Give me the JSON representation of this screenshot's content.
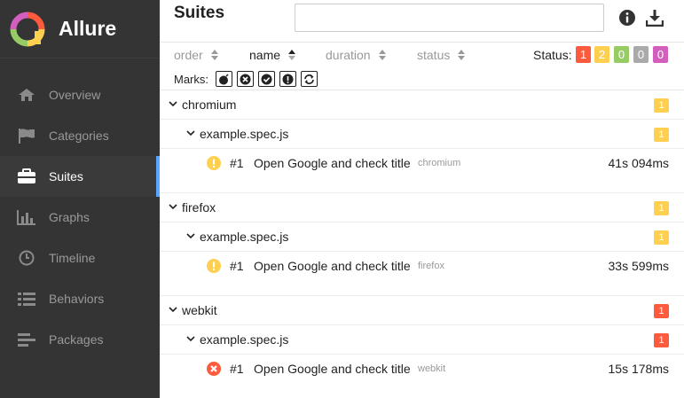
{
  "app": {
    "name": "Allure"
  },
  "sidebar": {
    "items": [
      {
        "label": "Overview",
        "icon": "home-icon",
        "active": false
      },
      {
        "label": "Categories",
        "icon": "flag-icon",
        "active": false
      },
      {
        "label": "Suites",
        "icon": "briefcase-icon",
        "active": true
      },
      {
        "label": "Graphs",
        "icon": "bar-chart-icon",
        "active": false
      },
      {
        "label": "Timeline",
        "icon": "clock-icon",
        "active": false
      },
      {
        "label": "Behaviors",
        "icon": "list-icon",
        "active": false
      },
      {
        "label": "Packages",
        "icon": "align-left-icon",
        "active": false
      }
    ]
  },
  "header": {
    "title": "Suites",
    "search": {
      "value": "",
      "placeholder": ""
    }
  },
  "sort": {
    "columns": [
      "order",
      "name",
      "duration",
      "status"
    ],
    "active": "name"
  },
  "status_filter": {
    "label": "Status:",
    "counts": [
      "1",
      "2",
      "0",
      "0",
      "0"
    ],
    "colors": [
      "#fd5a3e",
      "#ffd050",
      "#97cc64",
      "#aaaaaa",
      "#d35ebe"
    ]
  },
  "marks": {
    "label": "Marks:",
    "icons": [
      "bomb-icon",
      "times-circle-icon",
      "check-circle-icon",
      "exclamation-circle-icon",
      "refresh-icon"
    ]
  },
  "suites": [
    {
      "name": "chromium",
      "count": "1",
      "color": "#ffd050",
      "files": [
        {
          "name": "example.spec.js",
          "count": "1",
          "color": "#ffd050",
          "tests": [
            {
              "num": "#1",
              "title": "Open Google and check title",
              "tag": "chromium",
              "duration": "41s 094ms",
              "status": "broken"
            }
          ]
        }
      ]
    },
    {
      "name": "firefox",
      "count": "1",
      "color": "#ffd050",
      "files": [
        {
          "name": "example.spec.js",
          "count": "1",
          "color": "#ffd050",
          "tests": [
            {
              "num": "#1",
              "title": "Open Google and check title",
              "tag": "firefox",
              "duration": "33s 599ms",
              "status": "broken"
            }
          ]
        }
      ]
    },
    {
      "name": "webkit",
      "count": "1",
      "color": "#fd5a3e",
      "files": [
        {
          "name": "example.spec.js",
          "count": "1",
          "color": "#fd5a3e",
          "tests": [
            {
              "num": "#1",
              "title": "Open Google and check title",
              "tag": "webkit",
              "duration": "15s 178ms",
              "status": "failed"
            }
          ]
        }
      ]
    }
  ]
}
